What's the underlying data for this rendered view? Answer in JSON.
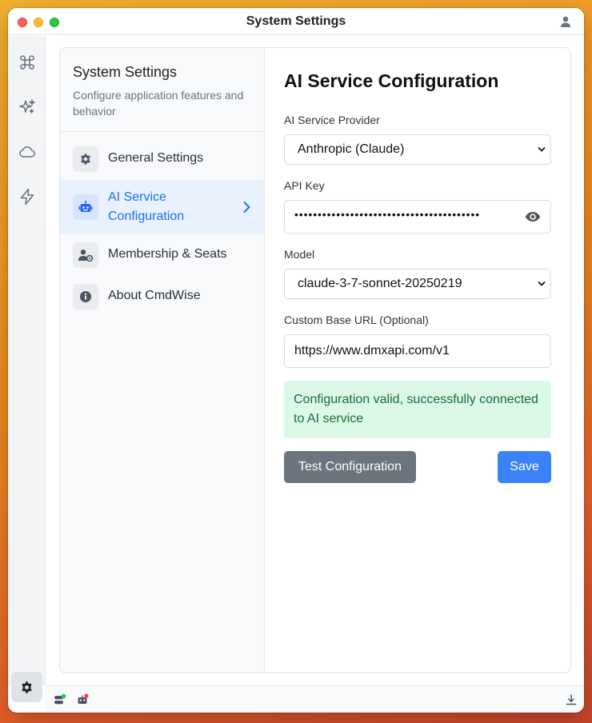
{
  "window": {
    "title": "System Settings"
  },
  "sidebar": {
    "title": "System Settings",
    "description": "Configure application features and behavior",
    "items": [
      {
        "label": "General Settings",
        "icon": "gear-icon",
        "active": false
      },
      {
        "label": "AI Service Configuration",
        "icon": "robot-icon",
        "active": true
      },
      {
        "label": "Membership & Seats",
        "icon": "user-gear-icon",
        "active": false
      },
      {
        "label": "About CmdWise",
        "icon": "info-icon",
        "active": false
      }
    ]
  },
  "main": {
    "title": "AI Service Configuration",
    "provider": {
      "label": "AI Service Provider",
      "value": "Anthropic (Claude)"
    },
    "api_key": {
      "label": "API Key",
      "masked_value": "••••••••••••••••••••••••••••••••••••••••"
    },
    "model": {
      "label": "Model",
      "value": "claude-3-7-sonnet-20250219"
    },
    "base_url": {
      "label": "Custom Base URL (Optional)",
      "value": "https://www.dmxapi.com/v1"
    },
    "status_message": "Configuration valid, successfully connected to AI service",
    "test_button": "Test Configuration",
    "save_button": "Save"
  },
  "colors": {
    "accent": "#3b82f6",
    "active_text": "#1f6feb",
    "success_bg": "#dcf8e6",
    "success_text": "#1c6b36",
    "secondary_button": "#6c747d"
  }
}
